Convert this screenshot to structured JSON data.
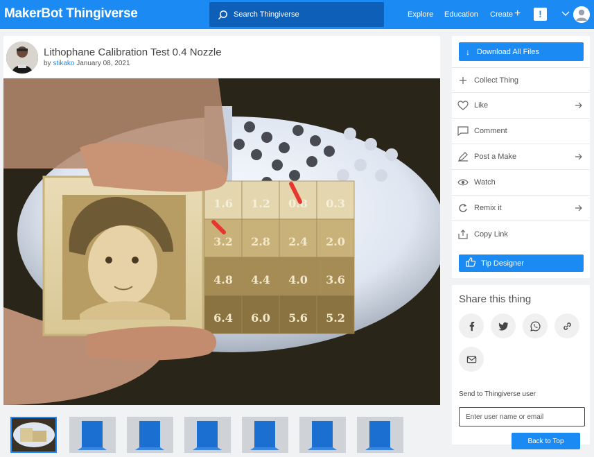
{
  "header": {
    "logo_left": "MakerBot",
    "logo_right": "Thingiverse",
    "search_placeholder": "Search Thingiverse",
    "nav": {
      "explore": "Explore",
      "education": "Education",
      "create": "Create"
    },
    "alert_glyph": "!",
    "plus_glyph": "+"
  },
  "thing": {
    "title": "Lithophane Calibration Test 0.4 Nozzle",
    "by": "by",
    "author": "stikako",
    "date": "January 08, 2021"
  },
  "photo": {
    "grid_values": [
      [
        "1.6",
        "1.2",
        "0.8",
        "0.3"
      ],
      [
        "3.2",
        "2.8",
        "2.4",
        "2.0"
      ],
      [
        "4.8",
        "4.4",
        "4.0",
        "3.6"
      ],
      [
        "6.4",
        "6.0",
        "5.6",
        "5.2"
      ]
    ]
  },
  "thumbnails": {
    "count": 7,
    "active_index": 0
  },
  "sidebar": {
    "download_label": "Download All Files",
    "actions": [
      {
        "label": "Collect Thing",
        "icon": "plus-icon",
        "has_arrow": false
      },
      {
        "label": "Like",
        "icon": "heart-icon",
        "has_arrow": true
      },
      {
        "label": "Comment",
        "icon": "comment-icon",
        "has_arrow": false
      },
      {
        "label": "Post a Make",
        "icon": "pencil-icon",
        "has_arrow": true
      },
      {
        "label": "Watch",
        "icon": "eye-icon",
        "has_arrow": false
      },
      {
        "label": "Remix it",
        "icon": "remix-icon",
        "has_arrow": true
      },
      {
        "label": "Copy Link",
        "icon": "share-icon",
        "has_arrow": false
      }
    ],
    "tip_label": "Tip Designer"
  },
  "share": {
    "title": "Share this thing",
    "icons": [
      "facebook-icon",
      "twitter-icon",
      "whatsapp-icon",
      "link-icon",
      "email-icon"
    ],
    "send_label": "Send to Thingiverse user",
    "send_placeholder": "Enter user name or email"
  },
  "back_to_top": "Back to Top",
  "colors": {
    "primary": "#1b8af2",
    "search_bg": "#0e5fb8",
    "page_bg": "#f1f2f4"
  }
}
